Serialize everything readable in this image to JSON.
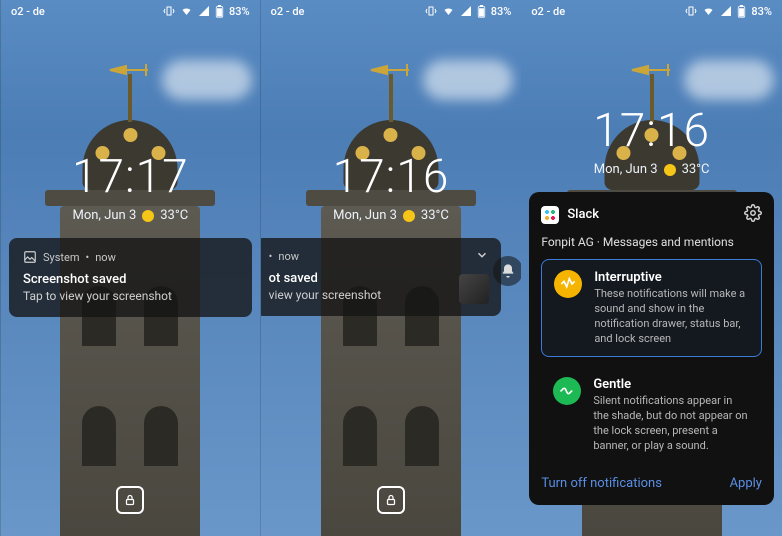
{
  "status": {
    "carrier": "o2 - de",
    "battery_pct": "83%"
  },
  "screens": [
    {
      "time": "17:17",
      "date": "Mon, Jun 3",
      "temp": "33°C",
      "notification": {
        "app": "System",
        "when": "now",
        "sep": "•",
        "title": "Screenshot saved",
        "body": "Tap to view your screenshot"
      }
    },
    {
      "time": "17:16",
      "date": "Mon, Jun 3",
      "temp": "33°C",
      "notification": {
        "app": "",
        "when": "now",
        "sep": "•",
        "title": "ot saved",
        "body": "view your screenshot"
      }
    },
    {
      "time": "17:16",
      "date": "Mon, Jun 3",
      "temp": "33°C",
      "panel": {
        "app_name": "Slack",
        "subtitle": "Fonpit AG · Messages and mentions",
        "options": [
          {
            "key": "interruptive",
            "title": "Interruptive",
            "desc": "These notifications will make a sound and show in the notification drawer, status bar, and lock screen",
            "selected": true,
            "color": "#f5b400"
          },
          {
            "key": "gentle",
            "title": "Gentle",
            "desc": "Silent notifications appear in the shade, but do not appear on the lock screen, present a banner, or play a sound.",
            "selected": false,
            "color": "#1db954"
          }
        ],
        "turn_off": "Turn off notifications",
        "apply": "Apply"
      }
    }
  ]
}
